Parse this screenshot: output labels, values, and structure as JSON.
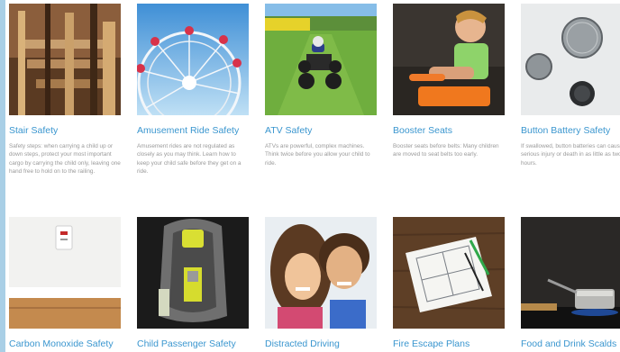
{
  "cards": [
    {
      "title": "Stair Safety",
      "desc": "Safety steps: when carrying a child up or down steps, protect your most important cargo by carrying the child only, leaving one hand free to hold on to the railing.",
      "image": "wooden-staircase"
    },
    {
      "title": "Amusement Ride Safety",
      "desc": "Amusement rides are not regulated as closely as you may think. Learn how to keep your child safe before they get on a ride.",
      "image": "ferris-wheel"
    },
    {
      "title": "ATV Safety",
      "desc": "ATVs are powerful, complex machines. Think twice before you allow your child to ride.",
      "image": "child-on-atv"
    },
    {
      "title": "Booster Seats",
      "desc": "Booster seats before belts: Many children are moved to seat belts too early.",
      "image": "child-in-booster-seat"
    },
    {
      "title": "Button Battery Safety",
      "desc": "If swallowed, button batteries can cause serious injury or death in as little as two hours.",
      "image": "button-batteries"
    },
    {
      "title": "Carbon Monoxide Safety",
      "desc": "",
      "image": "co-detector"
    },
    {
      "title": "Child Passenger Safety",
      "desc": "",
      "image": "car-seat"
    },
    {
      "title": "Distracted Driving",
      "desc": "",
      "image": "two-children"
    },
    {
      "title": "Fire Escape Plans",
      "desc": "",
      "image": "floor-plan-sketch"
    },
    {
      "title": "Food and Drink Scalds",
      "desc": "",
      "image": "pot-on-stove"
    }
  ]
}
